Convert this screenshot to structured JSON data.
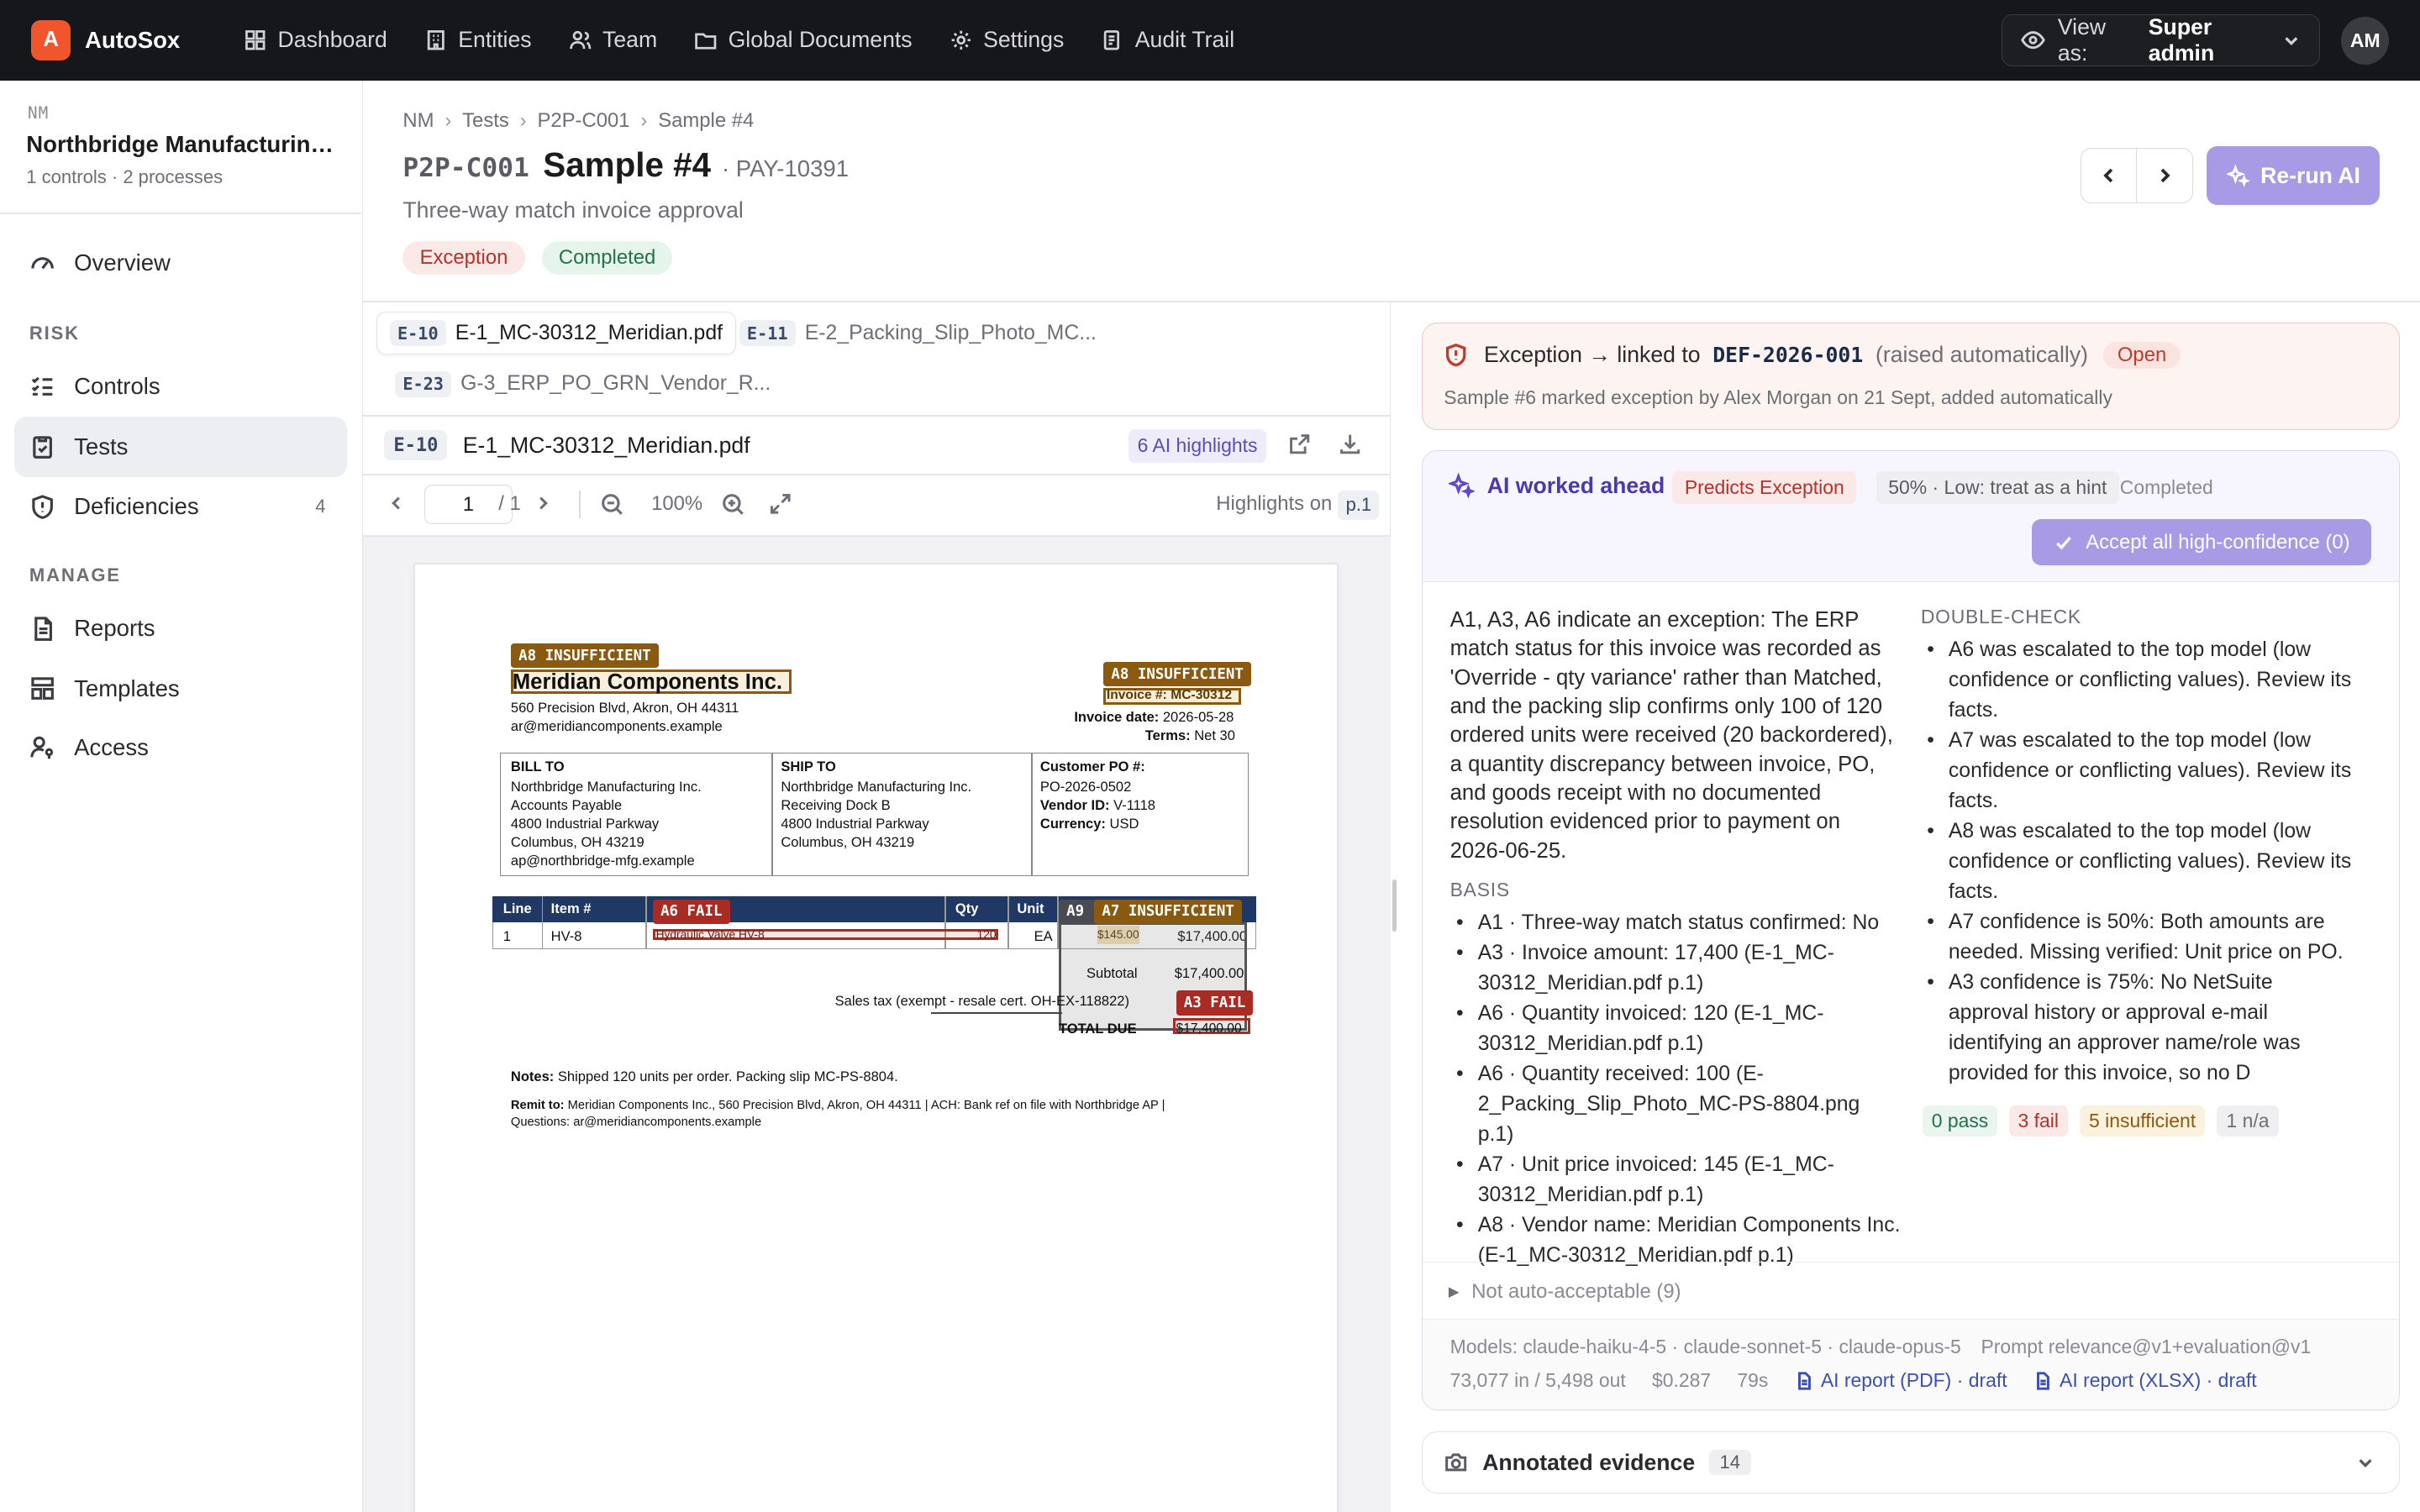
{
  "app": {
    "logo_letter": "A",
    "name": "AutoSox"
  },
  "nav": {
    "dashboard": "Dashboard",
    "entities": "Entities",
    "team": "Team",
    "global_documents": "Global Documents",
    "settings": "Settings",
    "audit_trail": "Audit Trail"
  },
  "view_as": {
    "prefix": "View as:",
    "role": "Super admin"
  },
  "user": {
    "initials": "AM"
  },
  "sidebar": {
    "org_code": "NM",
    "org_name": "Northbridge Manufacturing Inc.",
    "org_meta": "1 controls · 2 processes",
    "overview": "Overview",
    "risk_heading": "RISK",
    "controls": "Controls",
    "tests": "Tests",
    "deficiencies": "Deficiencies",
    "deficiencies_count": "4",
    "manage_heading": "MANAGE",
    "reports": "Reports",
    "templates": "Templates",
    "access": "Access"
  },
  "breadcrumb": [
    "NM",
    "Tests",
    "P2P-C001",
    "Sample #4"
  ],
  "header": {
    "control_code": "P2P-C001",
    "title": "Sample #4",
    "ref": "· PAY-10391",
    "subtitle": "Three-way match invoice approval",
    "status_exception": "Exception",
    "status_completed": "Completed",
    "rerun_label": "Re-run AI"
  },
  "evidence": {
    "tabs": [
      {
        "tag": "E-10",
        "name": "E-1_MC-30312_Meridian.pdf"
      },
      {
        "tag": "E-11",
        "name": "E-2_Packing_Slip_Photo_MC..."
      },
      {
        "tag": "E-23",
        "name": "G-3_ERP_PO_GRN_Vendor_R..."
      }
    ],
    "current_tag": "E-10",
    "current_name": "E-1_MC-30312_Meridian.pdf",
    "highlights_badge": "6 AI highlights",
    "page_value": "1",
    "page_total": "/ 1",
    "zoom": "100%",
    "highlights_on": "Highlights on",
    "highlights_page": "p.1"
  },
  "invoice": {
    "vendor": "Meridian Components Inc.",
    "vendor_addr": "560 Precision Blvd, Akron, OH 44311",
    "vendor_email": "ar@meridiancomponents.example",
    "invoice_no": "Invoice #: MC-30312",
    "invoice_date_label": "Invoice date:",
    "invoice_date": "2026-05-28",
    "terms_label": "Terms:",
    "terms": "Net 30",
    "bill_to_h": "BILL TO",
    "bill_to": [
      "Northbridge Manufacturing Inc.",
      "Accounts Payable",
      "4800 Industrial Parkway",
      "Columbus, OH 43219",
      "ap@northbridge-mfg.example"
    ],
    "ship_to_h": "SHIP TO",
    "ship_to": [
      "Northbridge Manufacturing Inc.",
      "Receiving Dock B",
      "4800 Industrial Parkway",
      "Columbus, OH 43219"
    ],
    "po_label": "Customer PO #:",
    "po": "PO-2026-0502",
    "vendor_id_label": "Vendor ID:",
    "vendor_id": "V-1118",
    "currency_label": "Currency:",
    "currency": "USD",
    "col_line": "Line",
    "col_item": "Item #",
    "col_qty": "Qty",
    "col_unit": "Unit",
    "row_line": "1",
    "row_item": "HV-8",
    "row_desc": "Hydraulic Valve HV-8",
    "row_qty": "120",
    "row_unit": "EA",
    "row_price": "$145.00",
    "row_amount": "$17,400.00",
    "subtotal_label": "Subtotal",
    "subtotal": "$17,400.00",
    "tax_label": "Sales tax (exempt - resale cert. OH-EX-118822)",
    "total_label": "TOTAL DUE",
    "total": "$17,400.00",
    "notes_label": "Notes:",
    "notes": "Shipped 120 units per order. Packing slip MC-PS-8804.",
    "remit_label": "Remit to:",
    "remit": "Meridian Components Inc., 560 Precision Blvd, Akron, OH 44311 | ACH: Bank ref on file with Northbridge AP |",
    "questions": "Questions: ar@meridiancomponents.example",
    "hl_a8_1": "A8 INSUFFICIENT",
    "hl_a8_2": "A8 INSUFFICIENT",
    "hl_a6": "A6 FAIL",
    "hl_a9": "A9 I",
    "hl_a7": "A7 INSUFFICIENT",
    "hl_a3": "A3 FAIL",
    "colors": {
      "insufficient": "#8a5a10",
      "fail": "#a82b24",
      "table_header": "#1f3864"
    }
  },
  "exception": {
    "prefix": "Exception → linked to",
    "def_id": "DEF-2026-001",
    "raised": "(raised automatically)",
    "status": "Open",
    "sub": "Sample #6 marked exception by Alex Morgan on 21 Sept, added automatically"
  },
  "ai": {
    "title": "AI worked ahead",
    "prediction": "Predicts Exception",
    "confidence": "50% · Low: treat as a hint",
    "status": "Completed",
    "accept_label": "Accept all high-confidence (0)",
    "summary": "A1, A3, A6 indicate an exception: The ERP match status for this invoice was recorded as 'Override - qty variance' rather than Matched, and the packing slip confirms only 100 of 120 ordered units were received (20 backordered), a quantity discrepancy between invoice, PO, and goods receipt with no documented resolution evidenced prior to payment on 2026-06-25.",
    "basis_heading": "BASIS",
    "basis": [
      "A1 · Three-way match status confirmed: No",
      "A3 · Invoice amount: 17,400 (E-1_MC-30312_Meridian.pdf p.1)",
      "A6 · Quantity invoiced: 120 (E-1_MC-30312_Meridian.pdf p.1)",
      "A6 · Quantity received: 100 (E-2_Packing_Slip_Photo_MC-PS-8804.png p.1)",
      "A7 · Unit price invoiced: 145 (E-1_MC-30312_Meridian.pdf p.1)",
      "A8 · Vendor name: Meridian Components Inc. (E-1_MC-30312_Meridian.pdf p.1)"
    ],
    "double_check_heading": "DOUBLE-CHECK",
    "double_check": [
      "A6 was escalated to the top model (low confidence or conflicting values). Review its facts.",
      "A7 was escalated to the top model (low confidence or conflicting values). Review its facts.",
      "A8 was escalated to the top model (low confidence or conflicting values). Review its facts.",
      "A7 confidence is 50%: Both amounts are needed. Missing verified: Unit price on PO.",
      "A3 confidence is 75%: No NetSuite approval history or approval e-mail identifying an approver name/role was provided for this invoice, so no D"
    ],
    "stats": {
      "pass": "0 pass",
      "fail": "3 fail",
      "insufficient": "5 insufficient",
      "na": "1 n/a"
    },
    "not_auto": "Not auto-acceptable (9)",
    "models": "Models: claude-haiku-4-5 · claude-sonnet-5 · claude-opus-5",
    "prompt": "Prompt relevance@v1+evaluation@v1",
    "tokens": "73,077 in / 5,498 out",
    "cost": "$0.287",
    "duration": "79s",
    "report_pdf": "AI report (PDF) · draft",
    "report_xlsx": "AI report (XLSX) · draft"
  },
  "annotated": {
    "label": "Annotated evidence",
    "count": "14"
  }
}
